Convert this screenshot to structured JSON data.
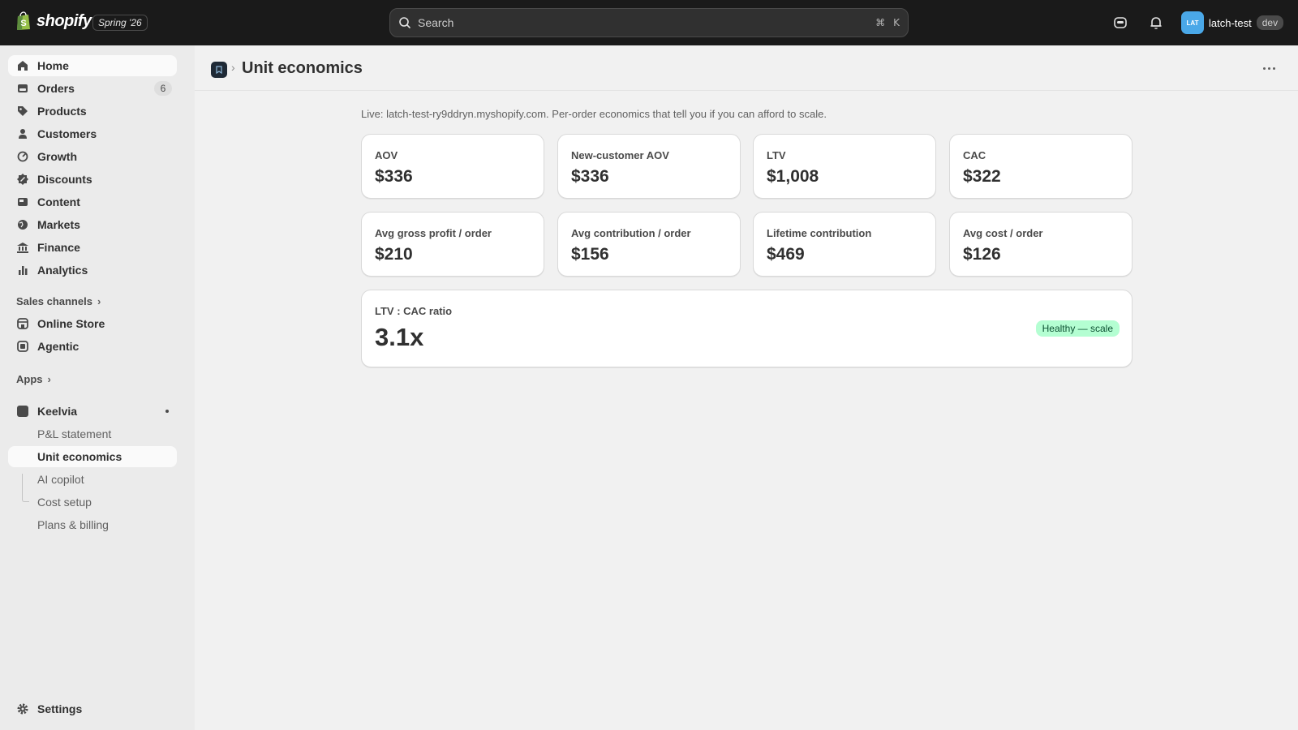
{
  "topbar": {
    "brand": "shopify",
    "edition": "Spring '26",
    "search_placeholder": "Search",
    "shortcut_cmd": "⌘",
    "shortcut_key": "K",
    "store_initials": "LAT",
    "store_name": "latch-test",
    "env_badge": "dev"
  },
  "sidebar": {
    "items": [
      {
        "label": "Home",
        "icon": "home-icon"
      },
      {
        "label": "Orders",
        "icon": "orders-icon",
        "badge": "6"
      },
      {
        "label": "Products",
        "icon": "tag-icon"
      },
      {
        "label": "Customers",
        "icon": "person-icon"
      },
      {
        "label": "Growth",
        "icon": "growth-icon"
      },
      {
        "label": "Discounts",
        "icon": "discount-icon"
      },
      {
        "label": "Content",
        "icon": "content-icon"
      },
      {
        "label": "Markets",
        "icon": "globe-icon"
      },
      {
        "label": "Finance",
        "icon": "bank-icon"
      },
      {
        "label": "Analytics",
        "icon": "bar-chart-icon"
      }
    ],
    "sales_channels_label": "Sales channels",
    "channels": [
      {
        "label": "Online Store",
        "icon": "store-icon"
      },
      {
        "label": "Agentic",
        "icon": "agentic-icon"
      }
    ],
    "apps_label": "Apps",
    "app": {
      "label": "Keelvia",
      "icon": "app-icon"
    },
    "app_subitems": [
      {
        "label": "P&L statement"
      },
      {
        "label": "Unit economics"
      },
      {
        "label": "AI copilot"
      },
      {
        "label": "Cost setup"
      },
      {
        "label": "Plans & billing"
      }
    ],
    "settings_label": "Settings"
  },
  "page": {
    "title": "Unit economics",
    "subtitle": "Live: latch-test-ry9ddryn.myshopify.com. Per-order economics that tell you if you can afford to scale.",
    "metrics": [
      {
        "label": "AOV",
        "value": "$336"
      },
      {
        "label": "New-customer AOV",
        "value": "$336"
      },
      {
        "label": "LTV",
        "value": "$1,008"
      },
      {
        "label": "CAC",
        "value": "$322"
      },
      {
        "label": "Avg gross profit / order",
        "value": "$210"
      },
      {
        "label": "Avg contribution / order",
        "value": "$156"
      },
      {
        "label": "Lifetime contribution",
        "value": "$469"
      },
      {
        "label": "Avg cost / order",
        "value": "$126"
      }
    ],
    "ratio": {
      "label": "LTV : CAC ratio",
      "value": "3.1x",
      "status": "Healthy — scale"
    }
  },
  "colors": {
    "topbar_bg": "#1a1a1a",
    "sidebar_bg": "#ebebeb",
    "page_bg": "#f1f1f1",
    "healthy_badge_bg": "#b4fed2",
    "healthy_badge_text": "#0c5132",
    "store_avatar": "#4aa8e8"
  }
}
